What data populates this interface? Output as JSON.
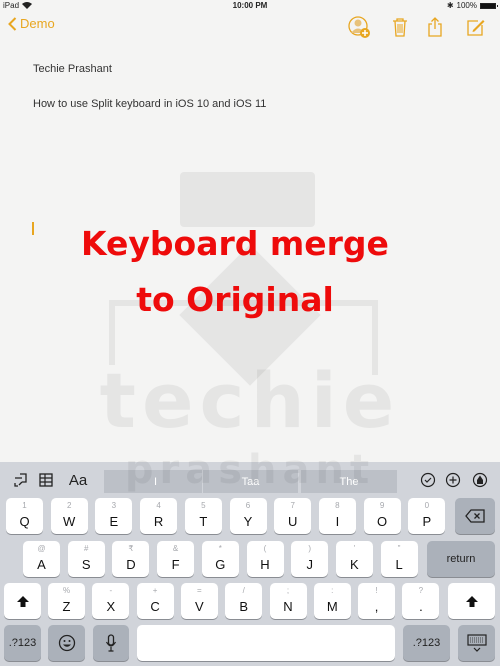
{
  "status_bar": {
    "device": "iPad",
    "time": "10:00 PM",
    "bluetooth": "bluetooth-icon",
    "battery_text": "100%",
    "battery_level": 1.0
  },
  "nav": {
    "back_label": "Demo",
    "icons": [
      "add-person-icon",
      "trash-icon",
      "share-icon",
      "compose-icon"
    ],
    "accent_color": "#e8a620"
  },
  "note": {
    "lines": [
      "Techie Prashant",
      "How to use Split keyboard in iOS 10 and iOS 11"
    ]
  },
  "overlay": {
    "line1": "Keyboard merge",
    "line2": "to Original",
    "color": "#ee0b0b"
  },
  "watermark": {
    "word1": "techie",
    "word2": "prashant"
  },
  "keyboard": {
    "toolbar": {
      "left_icons": [
        "undo-icon",
        "table-icon",
        "text-format-icon"
      ],
      "format_label": "Aa",
      "suggestions": [
        "I",
        "Taa",
        "The"
      ],
      "right_icons": [
        "checklist-icon",
        "add-icon",
        "markup-icon"
      ]
    },
    "row1": [
      {
        "hint": "1",
        "key": "Q"
      },
      {
        "hint": "2",
        "key": "W"
      },
      {
        "hint": "3",
        "key": "E"
      },
      {
        "hint": "4",
        "key": "R"
      },
      {
        "hint": "5",
        "key": "T"
      },
      {
        "hint": "6",
        "key": "Y"
      },
      {
        "hint": "7",
        "key": "U"
      },
      {
        "hint": "8",
        "key": "I"
      },
      {
        "hint": "9",
        "key": "O"
      },
      {
        "hint": "0",
        "key": "P"
      }
    ],
    "row2": [
      {
        "hint": "@",
        "key": "A"
      },
      {
        "hint": "#",
        "key": "S"
      },
      {
        "hint": "₹",
        "key": "D"
      },
      {
        "hint": "&",
        "key": "F"
      },
      {
        "hint": "*",
        "key": "G"
      },
      {
        "hint": "(",
        "key": "H"
      },
      {
        "hint": ")",
        "key": "J"
      },
      {
        "hint": "'",
        "key": "K"
      },
      {
        "hint": "\"",
        "key": "L"
      }
    ],
    "row3": [
      {
        "hint": "%",
        "key": "Z"
      },
      {
        "hint": "-",
        "key": "X"
      },
      {
        "hint": "+",
        "key": "C"
      },
      {
        "hint": "=",
        "key": "V"
      },
      {
        "hint": "/",
        "key": "B"
      },
      {
        "hint": ";",
        "key": "N"
      },
      {
        "hint": ":",
        "key": "M"
      },
      {
        "hint": "!",
        "key": ","
      },
      {
        "hint": "?",
        "key": "."
      }
    ],
    "return_label": "return",
    "numbers_label": ".?123",
    "space_label": ""
  }
}
